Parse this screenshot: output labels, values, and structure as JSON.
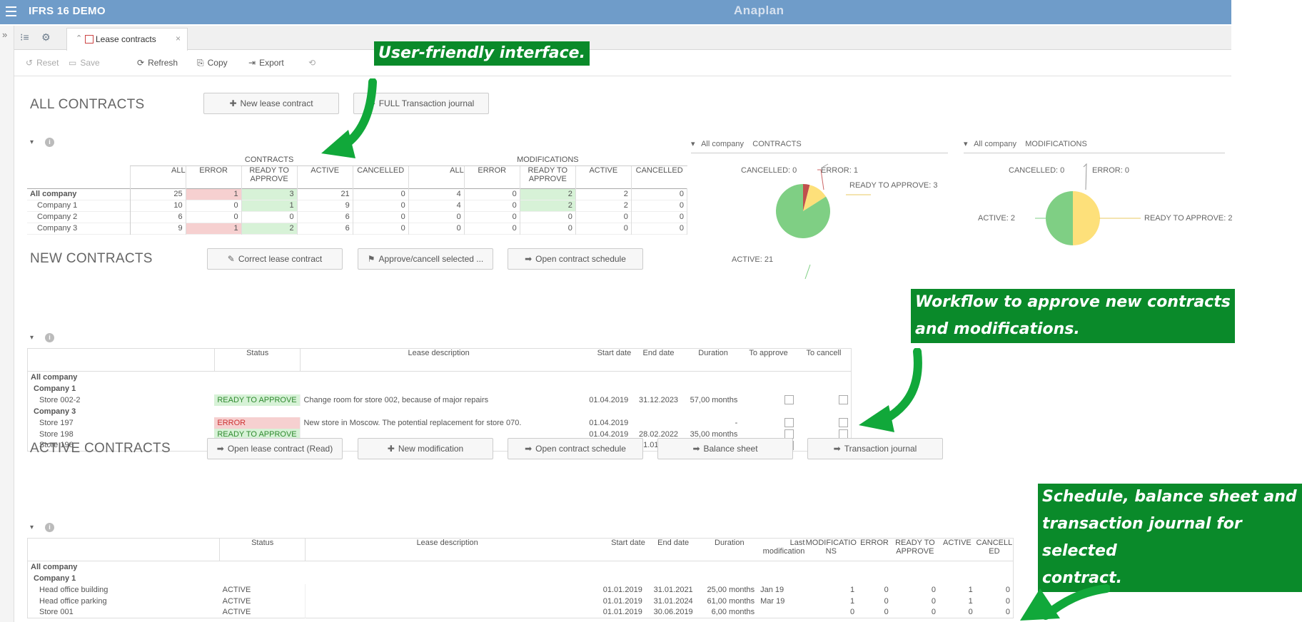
{
  "app": {
    "title": "IFRS 16 DEMO",
    "logo": "Anaplan"
  },
  "tab": {
    "label": "Lease contracts"
  },
  "toolbar": {
    "reset": "Reset",
    "save": "Save",
    "refresh": "Refresh",
    "copy": "Copy",
    "export": "Export"
  },
  "all_contracts": {
    "title": "ALL CONTRACTS",
    "btn_new": "New lease contract",
    "btn_journal": "FULL Transaction journal",
    "group_contracts": "CONTRACTS",
    "group_modifications": "MODIFICATIONS",
    "columns": [
      "ALL",
      "ERROR",
      "READY TO APPROVE",
      "ACTIVE",
      "CANCELLED",
      "ALL",
      "ERROR",
      "READY TO APPROVE",
      "ACTIVE",
      "CANCELLED"
    ],
    "rows": [
      {
        "label": "All company",
        "values": [
          "25",
          "1",
          "3",
          "21",
          "0",
          "4",
          "0",
          "2",
          "2",
          "0"
        ]
      },
      {
        "label": "Company 1",
        "values": [
          "10",
          "0",
          "1",
          "9",
          "0",
          "4",
          "0",
          "2",
          "2",
          "0"
        ]
      },
      {
        "label": "Company 2",
        "values": [
          "6",
          "0",
          "0",
          "6",
          "0",
          "0",
          "0",
          "0",
          "0",
          "0"
        ]
      },
      {
        "label": "Company 3",
        "values": [
          "9",
          "1",
          "2",
          "6",
          "0",
          "0",
          "0",
          "0",
          "0",
          "0"
        ]
      }
    ]
  },
  "pie_contracts": {
    "header_company": "All company",
    "header_title": "CONTRACTS",
    "label_cancelled": "CANCELLED: 0",
    "label_error": "ERROR: 1",
    "label_ready": "READY TO APPROVE: 3",
    "label_active": "ACTIVE: 21",
    "colors": {
      "active": "#7fcf84",
      "ready": "#fde07a",
      "error": "#c0504d"
    }
  },
  "pie_modifications": {
    "header_company": "All company",
    "header_title": "MODIFICATIONS",
    "label_cancelled": "CANCELLED: 0",
    "label_error": "ERROR: 0",
    "label_active": "ACTIVE: 2",
    "label_ready": "READY TO APPROVE: 2"
  },
  "chart_data": [
    {
      "type": "pie",
      "categories": [
        "ACTIVE",
        "READY TO APPROVE",
        "ERROR",
        "CANCELLED"
      ],
      "values": [
        21,
        3,
        1,
        0
      ],
      "title": "CONTRACTS"
    },
    {
      "type": "pie",
      "categories": [
        "ACTIVE",
        "READY TO APPROVE",
        "ERROR",
        "CANCELLED"
      ],
      "values": [
        2,
        2,
        0,
        0
      ],
      "title": "MODIFICATIONS"
    }
  ],
  "new_contracts": {
    "title": "NEW CONTRACTS",
    "btn_correct": "Correct lease contract",
    "btn_approve": "Approve/cancell selected ...",
    "btn_schedule": "Open contract schedule",
    "columns": [
      "Status",
      "Lease description",
      "Start date",
      "End date",
      "Duration",
      "To approve",
      "To cancell"
    ],
    "group_all": "All company",
    "company1": "Company 1",
    "company3": "Company 3",
    "rows": [
      {
        "name": "Store 002-2",
        "status": "READY TO APPROVE",
        "desc": "Change room for store 002, because of major repairs",
        "start": "01.04.2019",
        "end": "31.12.2023",
        "duration": "57,00 months"
      },
      {
        "name": "Store 197",
        "status": "ERROR",
        "desc": "New store in Moscow. The potential replacement for store 070.",
        "start": "01.04.2019",
        "end": "",
        "duration": "-"
      },
      {
        "name": "Store 198",
        "status": "READY TO APPROVE",
        "desc": "",
        "start": "01.04.2019",
        "end": "28.02.2022",
        "duration": "35,00 months"
      },
      {
        "name": "Store 196",
        "status": "READY TO APPROVE",
        "desc": "",
        "start": "01.02.2019",
        "end": "31.01.2022",
        "duration": "36,00 months"
      }
    ]
  },
  "active_contracts": {
    "title": "ACTIVE CONTRACTS",
    "btn_open": "Open lease contract (Read)",
    "btn_modification": "New modification",
    "btn_schedule": "Open contract schedule",
    "btn_balance": "Balance sheet",
    "btn_journal": "Transaction journal",
    "columns": [
      "Status",
      "Lease description",
      "Start date",
      "End date",
      "Duration",
      "Last modification",
      "MODIFICATIO NS",
      "ERROR",
      "READY TO APPROVE",
      "ACTIVE",
      "CANCELL ED"
    ],
    "group_all": "All company",
    "company1": "Company 1",
    "rows": [
      {
        "name": "Head office building",
        "status": "ACTIVE",
        "start": "01.01.2019",
        "end": "31.01.2021",
        "duration": "25,00 months",
        "lastmod": "Jan 19",
        "m": "1",
        "e": "0",
        "r": "0",
        "a": "1",
        "c": "0"
      },
      {
        "name": "Head office parking",
        "status": "ACTIVE",
        "start": "01.01.2019",
        "end": "31.01.2024",
        "duration": "61,00 months",
        "lastmod": "Mar 19",
        "m": "1",
        "e": "0",
        "r": "0",
        "a": "1",
        "c": "0"
      },
      {
        "name": "Store 001",
        "status": "ACTIVE",
        "start": "01.01.2019",
        "end": "30.06.2019",
        "duration": "6,00 months",
        "lastmod": "",
        "m": "0",
        "e": "0",
        "r": "0",
        "a": "0",
        "c": "0"
      }
    ]
  },
  "annotations": {
    "a1": "User-friendly interface.",
    "a2_line1": "Workflow to approve new contracts",
    "a2_line2": "and modifications.",
    "a3_line1": "Schedule, balance sheet and",
    "a3_line2": "transaction journal for selected",
    "a3_line3": "contract."
  }
}
